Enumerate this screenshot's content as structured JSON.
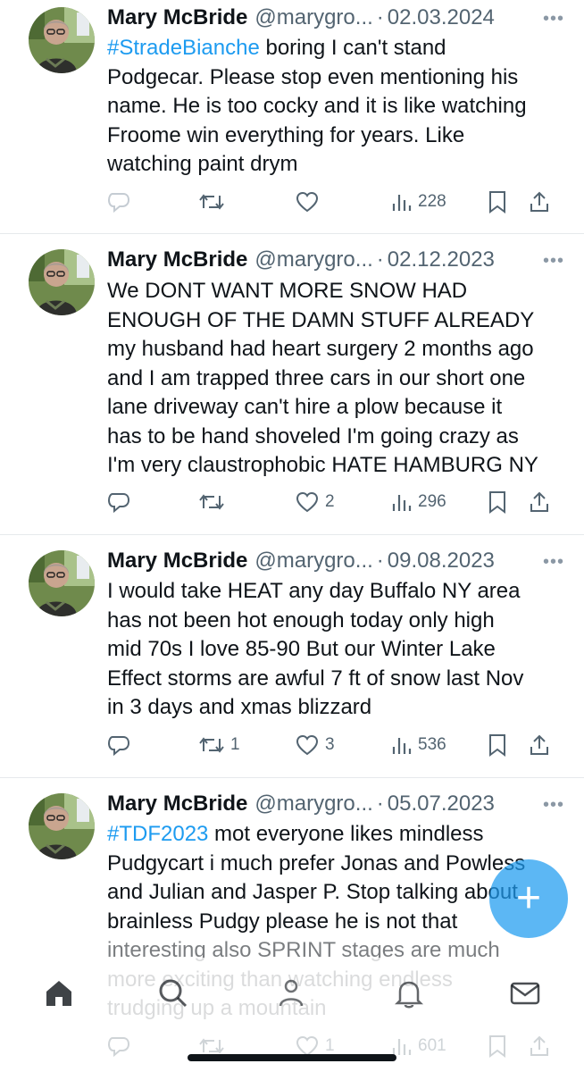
{
  "tweets": [
    {
      "name": "Mary McBride",
      "handle": "@marygro...",
      "date": "02.03.2024",
      "lines": [
        {
          "hashtag": "#StradeBianche",
          "rest": " boring I can't stand"
        },
        {
          "hashtag": "",
          "rest": "Podgecar. Please stop even mentioning his"
        },
        {
          "hashtag": "",
          "rest": "name. He is too cocky and it is like watching"
        },
        {
          "hashtag": "",
          "rest": "Froome win everything for years. Like"
        },
        {
          "hashtag": "",
          "rest": "watching paint drym"
        }
      ],
      "replies": "",
      "reposts": "",
      "likes": "",
      "views": "228"
    },
    {
      "name": "Mary McBride",
      "handle": "@marygro...",
      "date": "02.12.2023",
      "lines": [
        {
          "hashtag": "",
          "rest": "We DONT WANT MORE SNOW HAD"
        },
        {
          "hashtag": "",
          "rest": "ENOUGH OF THE DAMN STUFF ALREADY"
        },
        {
          "hashtag": "",
          "rest": "my husband had heart surgery 2 months ago"
        },
        {
          "hashtag": "",
          "rest": "and I am trapped three cars in our short one"
        },
        {
          "hashtag": "",
          "rest": "lane driveway can't hire a plow because it"
        },
        {
          "hashtag": "",
          "rest": "has to be hand shoveled I'm going crazy as"
        },
        {
          "hashtag": "",
          "rest": "I'm very claustrophobic HATE HAMBURG NY"
        }
      ],
      "replies": "",
      "reposts": "",
      "likes": "2",
      "views": "296"
    },
    {
      "name": "Mary McBride",
      "handle": "@marygro...",
      "date": "09.08.2023",
      "lines": [
        {
          "hashtag": "",
          "rest": "I would take HEAT any day Buffalo NY area"
        },
        {
          "hashtag": "",
          "rest": "has not been hot enough today only high"
        },
        {
          "hashtag": "",
          "rest": "mid 70s I love 85-90 But our Winter Lake"
        },
        {
          "hashtag": "",
          "rest": "Effect storms are awful 7 ft of snow last Nov"
        },
        {
          "hashtag": "",
          "rest": "in 3 days and xmas blizzard"
        }
      ],
      "replies": "",
      "reposts": "1",
      "likes": "3",
      "views": "536"
    },
    {
      "name": "Mary McBride",
      "handle": "@marygro...",
      "date": "05.07.2023",
      "lines": [
        {
          "hashtag": "#TDF2023",
          "rest": " mot everyone likes mindless"
        },
        {
          "hashtag": "",
          "rest": "Pudgycart i much prefer Jonas and Powless"
        },
        {
          "hashtag": "",
          "rest": "and Julian and Jasper P. Stop talking about"
        },
        {
          "hashtag": "",
          "rest": "brainless Pudgy please he is not that"
        },
        {
          "hashtag": "",
          "rest": "interesting also SPRINT stages are much"
        },
        {
          "hashtag": "",
          "rest": "more exciting than watching endless"
        },
        {
          "hashtag": "",
          "rest": "trudging up a mountain"
        }
      ],
      "replies": "",
      "reposts": "",
      "likes": "1",
      "views": "601"
    }
  ],
  "icons": {
    "reply": "reply-icon",
    "repost": "repost-icon",
    "like": "like-icon",
    "views": "views-icon",
    "bookmark": "bookmark-icon",
    "share": "share-icon",
    "more": "more-icon"
  },
  "more_label": "•••",
  "fab_label": "+",
  "nav": [
    "home-icon",
    "search-icon",
    "communities-icon",
    "notifications-icon",
    "messages-icon"
  ],
  "colors": {
    "accent": "#1d9bf0",
    "text": "#0f1419",
    "muted": "#536471",
    "divider": "#e6e9ec"
  }
}
